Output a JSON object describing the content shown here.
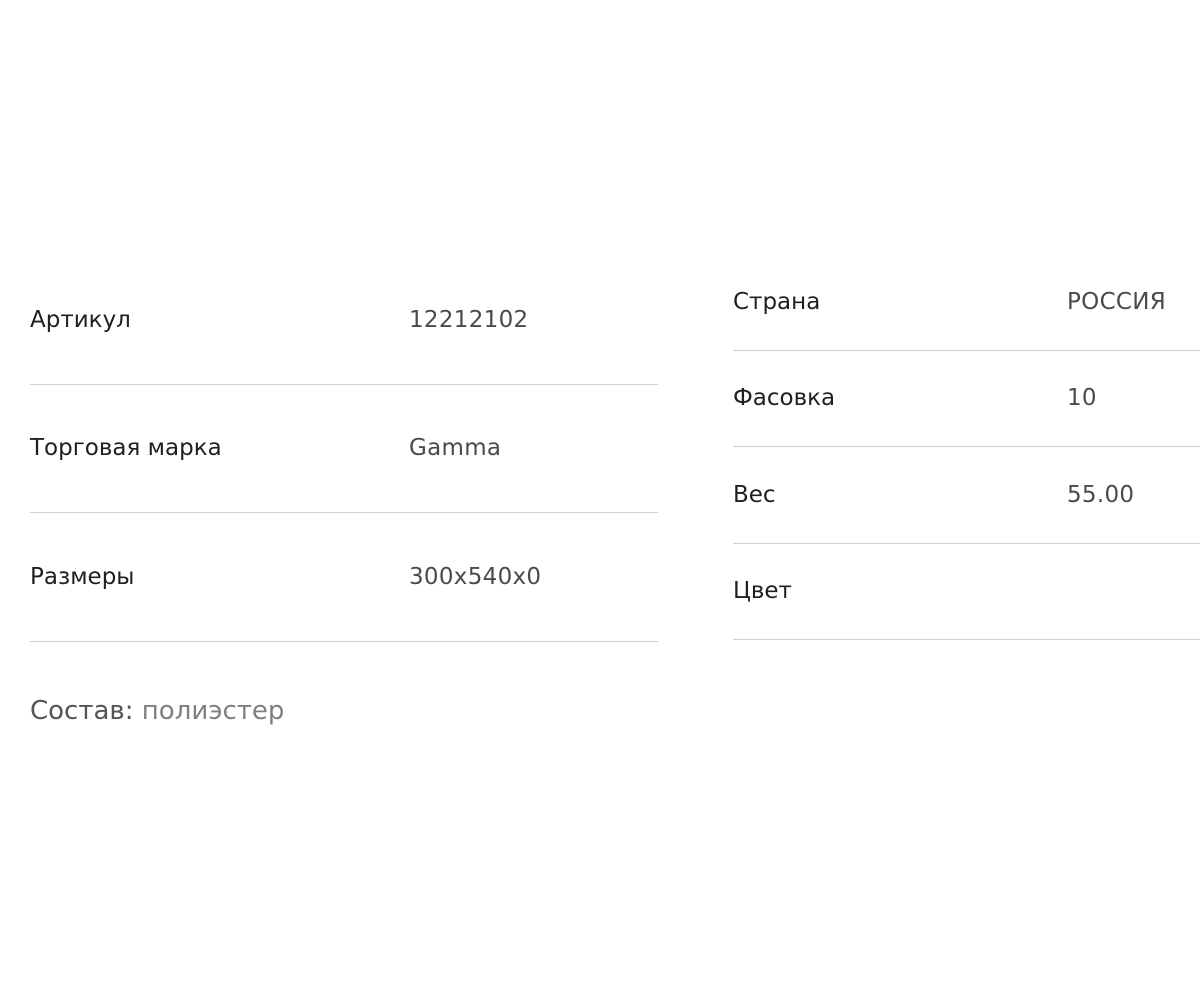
{
  "specs_left": [
    {
      "label": "Артикул",
      "value": "12212102"
    },
    {
      "label": "Торговая марка",
      "value": "Gamma"
    },
    {
      "label": "Размеры",
      "value": "300x540x0"
    }
  ],
  "specs_right": [
    {
      "label": "Страна",
      "value": "РОССИЯ"
    },
    {
      "label": "Фасовка",
      "value": "10"
    },
    {
      "label": "Вес",
      "value": "55.00"
    },
    {
      "label": "Цвет",
      "value": ""
    }
  ],
  "composition": {
    "label": "Состав:",
    "value": "полиэстер"
  }
}
